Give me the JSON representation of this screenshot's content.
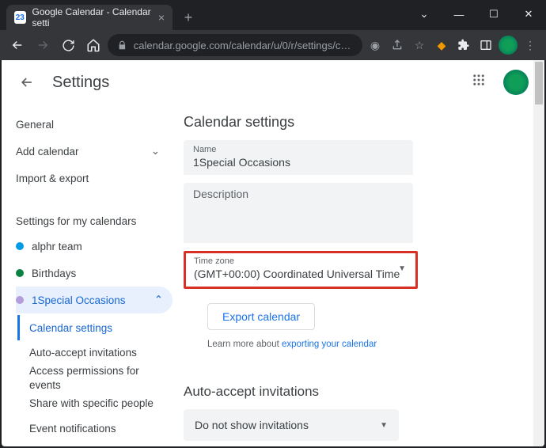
{
  "browser": {
    "tab_title": "Google Calendar - Calendar setti",
    "url": "calendar.google.com/calendar/u/0/r/settings/ca…"
  },
  "appbar": {
    "title": "Settings"
  },
  "sidebar": {
    "general": "General",
    "add_calendar": "Add calendar",
    "import_export": "Import & export",
    "group_title": "Settings for my calendars",
    "calendars": [
      {
        "label": "alphr team",
        "color": "#039be5"
      },
      {
        "label": "Birthdays",
        "color": "#0b8043"
      },
      {
        "label": "1Special Occasions",
        "color": "#b39ddb"
      }
    ],
    "sub_active": "Calendar settings",
    "subs": [
      "Auto-accept invitations",
      "Access permissions for events",
      "Share with specific people",
      "Event notifications"
    ]
  },
  "main": {
    "section_title": "Calendar settings",
    "name_label": "Name",
    "name_value": "1Special Occasions",
    "desc_label": "Description",
    "tz_label": "Time zone",
    "tz_value": "(GMT+00:00) Coordinated Universal Time",
    "export_btn": "Export calendar",
    "hint_prefix": "Learn more about ",
    "hint_link": "exporting your calendar",
    "auto_accept_title": "Auto-accept invitations",
    "auto_accept_value": "Do not show invitations"
  }
}
